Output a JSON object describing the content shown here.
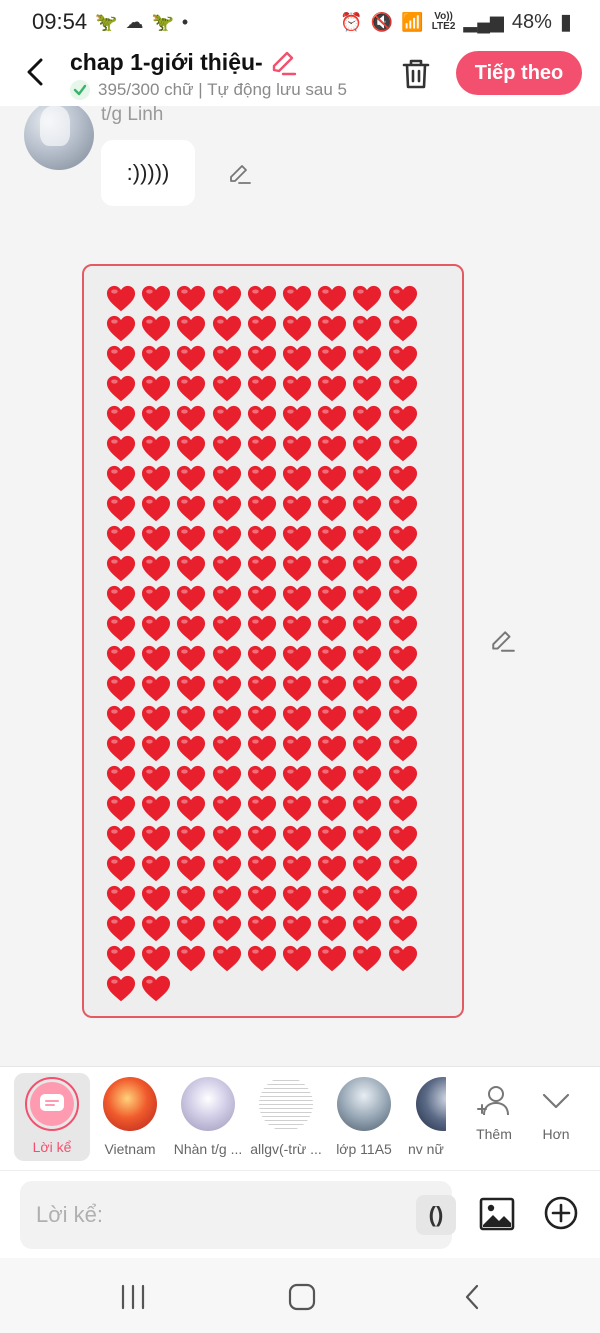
{
  "status_bar": {
    "time": "09:54",
    "left_icons": [
      "android-icon",
      "cloud-icon",
      "android-icon",
      "dot-icon"
    ],
    "network_top": "Vo))",
    "network_bottom": "LTE2",
    "battery": "48%"
  },
  "header": {
    "title": "chap 1-giới thiệu-",
    "subtitle": "395/300 chữ | Tự động lưu sau 5",
    "next_label": "Tiếp theo"
  },
  "message": {
    "author": "t/g Linh",
    "text": ":)))))"
  },
  "heart_image": {
    "rows": [
      9,
      9,
      9,
      9,
      9,
      9,
      9,
      9,
      9,
      9,
      9,
      9,
      9,
      9,
      9,
      9,
      9,
      9,
      9,
      9,
      9,
      9,
      9,
      2
    ],
    "heart_color": "#e8202e"
  },
  "characters": [
    {
      "name": "Lời kể",
      "active": true
    },
    {
      "name": "Vietnam",
      "active": false
    },
    {
      "name": "Nhàn t/g ...",
      "active": false
    },
    {
      "name": "allgv(-trừ ...",
      "active": false
    },
    {
      "name": "lớp 11A5",
      "active": false
    },
    {
      "name": "nv nữ",
      "active": false
    }
  ],
  "tools": {
    "add_label": "Thêm",
    "more_label": "Hơn"
  },
  "input": {
    "placeholder": "Lời kể:",
    "paren_label": "()"
  },
  "colors": {
    "accent": "#f2506e",
    "border_red": "#e35a63"
  }
}
